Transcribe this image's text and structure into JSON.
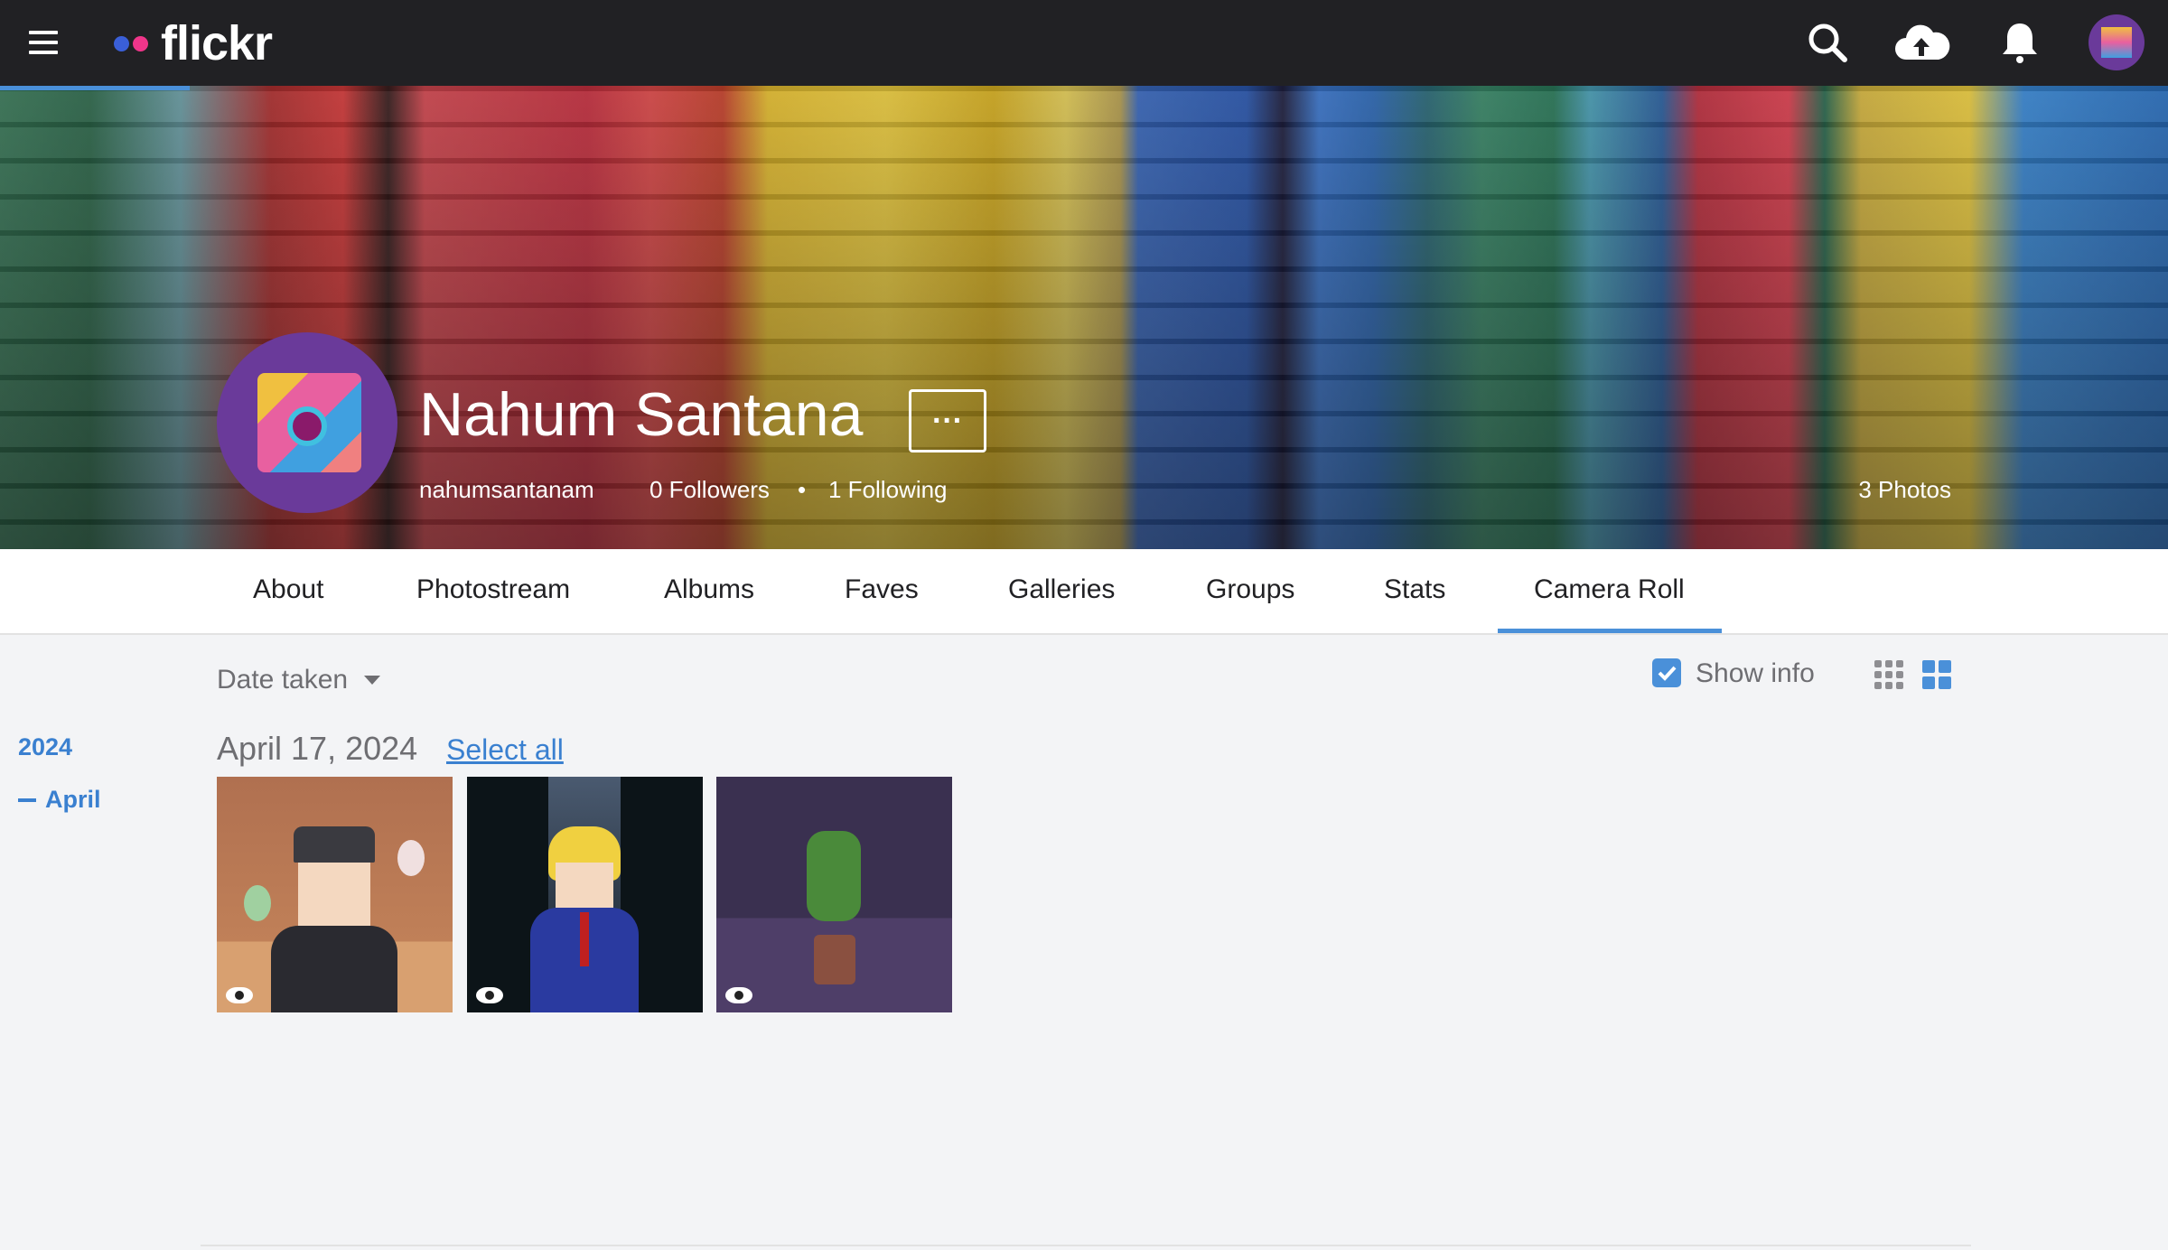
{
  "header": {
    "logo_text": "flickr",
    "logo_colors": [
      "#3a5fd8",
      "#f0358a"
    ],
    "icons": [
      "menu-icon",
      "search-icon",
      "upload-cloud-icon",
      "bell-icon",
      "avatar"
    ]
  },
  "profile": {
    "name": "Nahum Santana",
    "more_label": "···",
    "username": "nahumsantanam",
    "followers": "0 Followers",
    "separator": "•",
    "following": "1 Following",
    "photos": "3 Photos"
  },
  "tabs": [
    {
      "label": "About"
    },
    {
      "label": "Photostream"
    },
    {
      "label": "Albums"
    },
    {
      "label": "Faves"
    },
    {
      "label": "Galleries"
    },
    {
      "label": "Groups"
    },
    {
      "label": "Stats"
    },
    {
      "label": "Camera Roll",
      "active": true
    }
  ],
  "toolbar": {
    "sort_label": "Date taken",
    "show_info_label": "Show info",
    "show_info_checked": true,
    "accent": "#4a90d9"
  },
  "timeline": {
    "year": "2024",
    "month": "April"
  },
  "section": {
    "date": "April 17, 2024",
    "select_all": "Select all"
  },
  "photos": [
    {
      "subject": "boy in cap with ghost flames"
    },
    {
      "subject": "blond boy in blue suit"
    },
    {
      "subject": "green plant creature in pot"
    }
  ]
}
